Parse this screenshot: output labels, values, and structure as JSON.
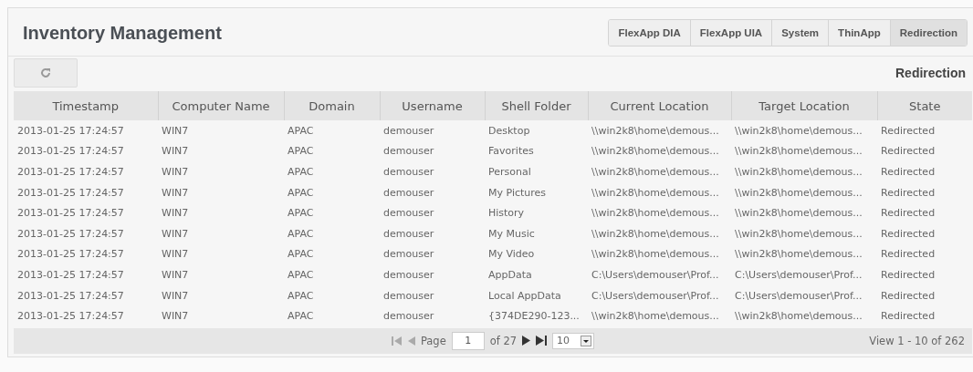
{
  "title": "Inventory Management",
  "tabs": [
    {
      "label": "FlexApp DIA",
      "selected": false
    },
    {
      "label": "FlexApp UIA",
      "selected": false
    },
    {
      "label": "System",
      "selected": false
    },
    {
      "label": "ThinApp",
      "selected": false
    },
    {
      "label": "Redirection",
      "selected": true
    }
  ],
  "toolbar": {
    "caption": "Redirection"
  },
  "table": {
    "columns": [
      "Timestamp",
      "Computer Name",
      "Domain",
      "Username",
      "Shell Folder",
      "Current Location",
      "Target Location",
      "State"
    ],
    "rows": [
      [
        "2013-01-25 17:24:57",
        "WIN7",
        "APAC",
        "demouser",
        "Desktop",
        "\\\\win2k8\\home\\demous...",
        "\\\\win2k8\\home\\demous...",
        "Redirected"
      ],
      [
        "2013-01-25 17:24:57",
        "WIN7",
        "APAC",
        "demouser",
        "Favorites",
        "\\\\win2k8\\home\\demous...",
        "\\\\win2k8\\home\\demous...",
        "Redirected"
      ],
      [
        "2013-01-25 17:24:57",
        "WIN7",
        "APAC",
        "demouser",
        "Personal",
        "\\\\win2k8\\home\\demous...",
        "\\\\win2k8\\home\\demous...",
        "Redirected"
      ],
      [
        "2013-01-25 17:24:57",
        "WIN7",
        "APAC",
        "demouser",
        "My Pictures",
        "\\\\win2k8\\home\\demous...",
        "\\\\win2k8\\home\\demous...",
        "Redirected"
      ],
      [
        "2013-01-25 17:24:57",
        "WIN7",
        "APAC",
        "demouser",
        "History",
        "\\\\win2k8\\home\\demous...",
        "\\\\win2k8\\home\\demous...",
        "Redirected"
      ],
      [
        "2013-01-25 17:24:57",
        "WIN7",
        "APAC",
        "demouser",
        "My Music",
        "\\\\win2k8\\home\\demous...",
        "\\\\win2k8\\home\\demous...",
        "Redirected"
      ],
      [
        "2013-01-25 17:24:57",
        "WIN7",
        "APAC",
        "demouser",
        "My Video",
        "\\\\win2k8\\home\\demous...",
        "\\\\win2k8\\home\\demous...",
        "Redirected"
      ],
      [
        "2013-01-25 17:24:57",
        "WIN7",
        "APAC",
        "demouser",
        "AppData",
        "C:\\Users\\demouser\\Prof...",
        "C:\\Users\\demouser\\Prof...",
        "Redirected"
      ],
      [
        "2013-01-25 17:24:57",
        "WIN7",
        "APAC",
        "demouser",
        "Local AppData",
        "C:\\Users\\demouser\\Prof...",
        "C:\\Users\\demouser\\Prof...",
        "Redirected"
      ],
      [
        "2013-01-25 17:24:57",
        "WIN7",
        "APAC",
        "demouser",
        "{374DE290-123...",
        "\\\\win2k8\\home\\demous...",
        "\\\\win2k8\\home\\demous...",
        "Redirected"
      ]
    ]
  },
  "pager": {
    "page_label": "Page",
    "page": "1",
    "of": "of 27",
    "page_size": "10",
    "summary": "View 1 - 10 of 262"
  }
}
